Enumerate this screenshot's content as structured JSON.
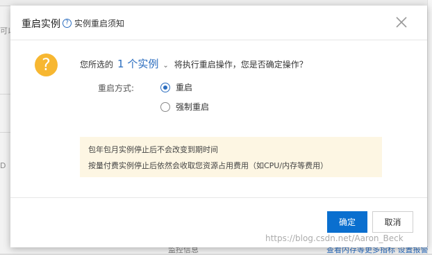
{
  "background": {
    "left_text_1": "可以",
    "left_text_2": "D",
    "bottom_left_text": "监控信息",
    "bottom_right_text": "查看内存等更多指标 设置报警"
  },
  "modal": {
    "title": "重启实例",
    "help_link": "实例重启须知",
    "close_icon": "close-icon",
    "confirm": {
      "prefix": "您所选的",
      "instance_count": "1 个实例",
      "suffix": "将执行重启操作，您是否确定操作？"
    },
    "method": {
      "label": "重启方式:",
      "options": [
        {
          "label": "重启",
          "checked": true
        },
        {
          "label": "强制重启",
          "checked": false
        }
      ]
    },
    "notice": [
      "包年包月实例停止后不会改变到期时间",
      "按量付费实例停止后依然会收取您资源占用费用（如CPU/内存等费用）"
    ],
    "buttons": {
      "ok": "确定",
      "cancel": "取消"
    }
  },
  "watermark": "https://blog.csdn.net/Aaron_Beck",
  "colors": {
    "primary": "#0a6fcf",
    "link": "#2b6dbf",
    "warning_icon": "#f7b731",
    "notice_bg": "#fdf6e3"
  }
}
